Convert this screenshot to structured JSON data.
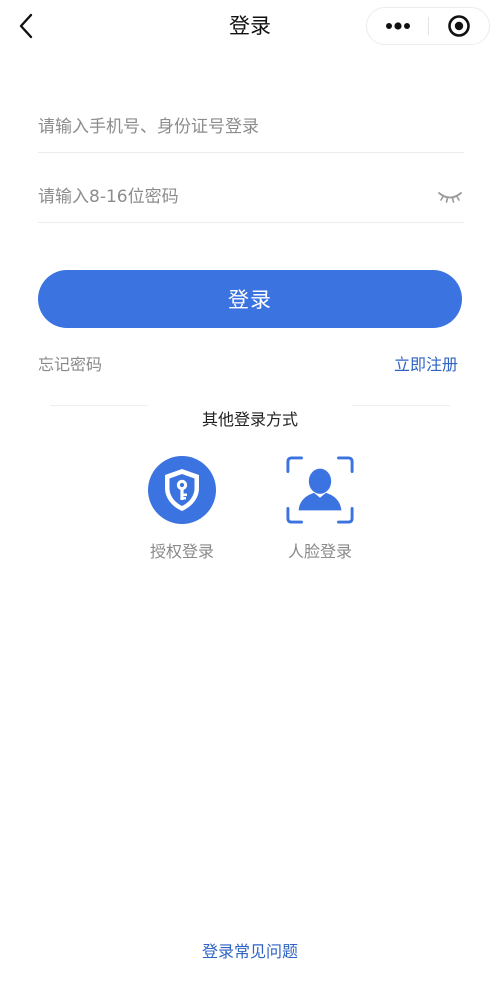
{
  "navbar": {
    "title": "登录",
    "back_icon": "chevron-left-icon",
    "more_icon": "more-dots-icon",
    "close_icon": "target-close-icon"
  },
  "form": {
    "account": {
      "value": "",
      "placeholder": "请输入手机号、身份证号登录"
    },
    "password": {
      "value": "",
      "placeholder": "请输入8-16位密码",
      "toggle_icon": "eye-closed-icon"
    },
    "login_button_label": "登录",
    "forgot_password_label": "忘记密码",
    "register_label": "立即注册"
  },
  "other_login": {
    "title": "其他登录方式",
    "methods": [
      {
        "label": "授权登录",
        "icon": "shield-key-icon"
      },
      {
        "label": "人脸登录",
        "icon": "face-scan-icon"
      }
    ]
  },
  "footer": {
    "faq_label": "登录常见问题"
  },
  "colors": {
    "primary": "#3b73e0",
    "link": "#2f64c4",
    "muted_text": "#8a8a8a",
    "divider": "#ececec"
  }
}
